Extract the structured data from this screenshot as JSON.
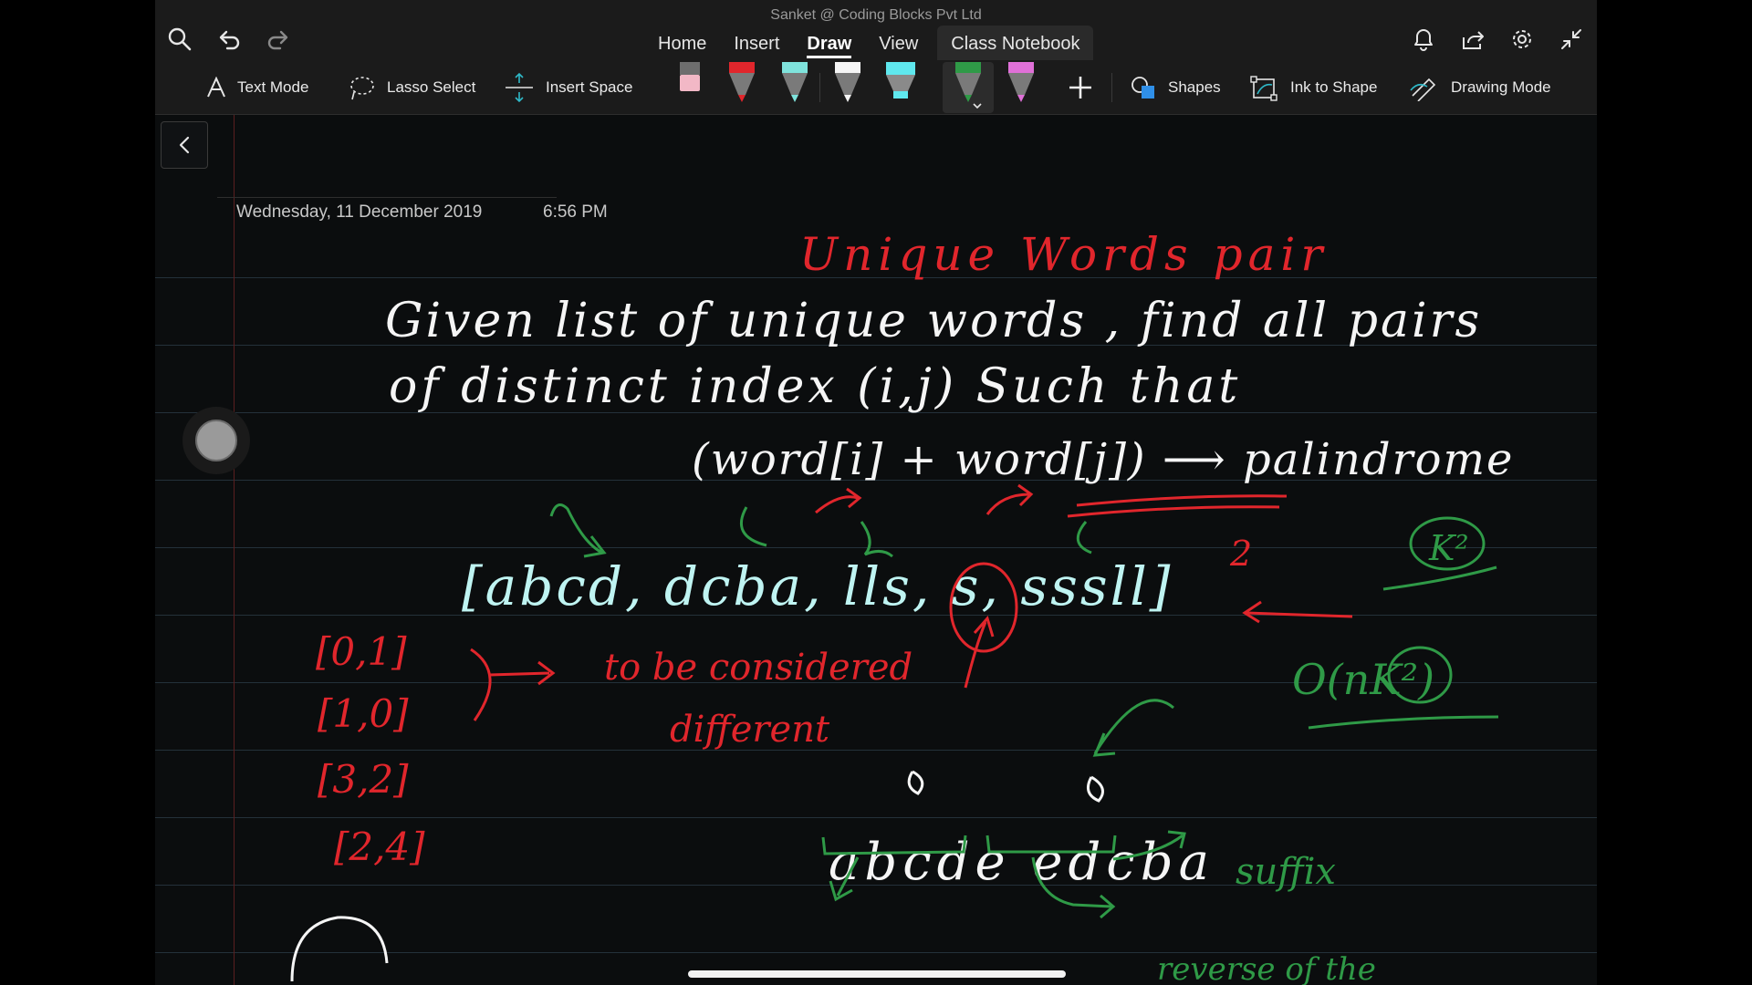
{
  "window": {
    "title": "Sanket @ Coding Blocks Pvt Ltd"
  },
  "tabs": [
    {
      "label": "Home"
    },
    {
      "label": "Insert"
    },
    {
      "label": "Draw"
    },
    {
      "label": "View"
    },
    {
      "label": "Class Notebook"
    }
  ],
  "active_tab": "Draw",
  "ribbon": {
    "text_mode": "Text Mode",
    "lasso_select": "Lasso Select",
    "insert_space": "Insert Space",
    "shapes": "Shapes",
    "ink_to_shape": "Ink to Shape",
    "drawing_mode": "Drawing Mode",
    "pens": [
      {
        "name": "eraser",
        "color": "#f2b8c6"
      },
      {
        "name": "red-pen",
        "color": "#e1262c"
      },
      {
        "name": "teal-pen",
        "color": "#7fe3dc"
      },
      {
        "name": "white-pen",
        "color": "#f5f5f5"
      },
      {
        "name": "cyan-highlighter",
        "color": "#5fe8ee"
      },
      {
        "name": "green-pen",
        "color": "#2f9a47"
      },
      {
        "name": "pink-pen",
        "color": "#e070d8"
      }
    ]
  },
  "page": {
    "date": "Wednesday, 11 December 2019",
    "time": "6:56 PM"
  },
  "ink": {
    "title": "Unique Words pair",
    "line1": "Given list of unique words , find all pairs",
    "line2": "of distinct index (i,j) Such that",
    "line3": "(word[i] + word[j]) ⟶ palindrome",
    "array": "[abcd, dcba, lls, s, sssll]",
    "pair1": "[0,1]",
    "pair2": "[1,0]",
    "pair3": "[3,2]",
    "pair4": "[2,4]",
    "note1": "to be considered",
    "note2": "different",
    "complexity1": "K²",
    "complexity2": "O(nK²)",
    "example": "abcde edcba",
    "suffix": "suffix",
    "reverse": "reverse of the",
    "two": "2"
  },
  "colors": {
    "white_ink": "#f5f5f5",
    "red_ink": "#e1262c",
    "cyan_ink": "#bff4f2",
    "green_ink": "#2f9a47"
  }
}
